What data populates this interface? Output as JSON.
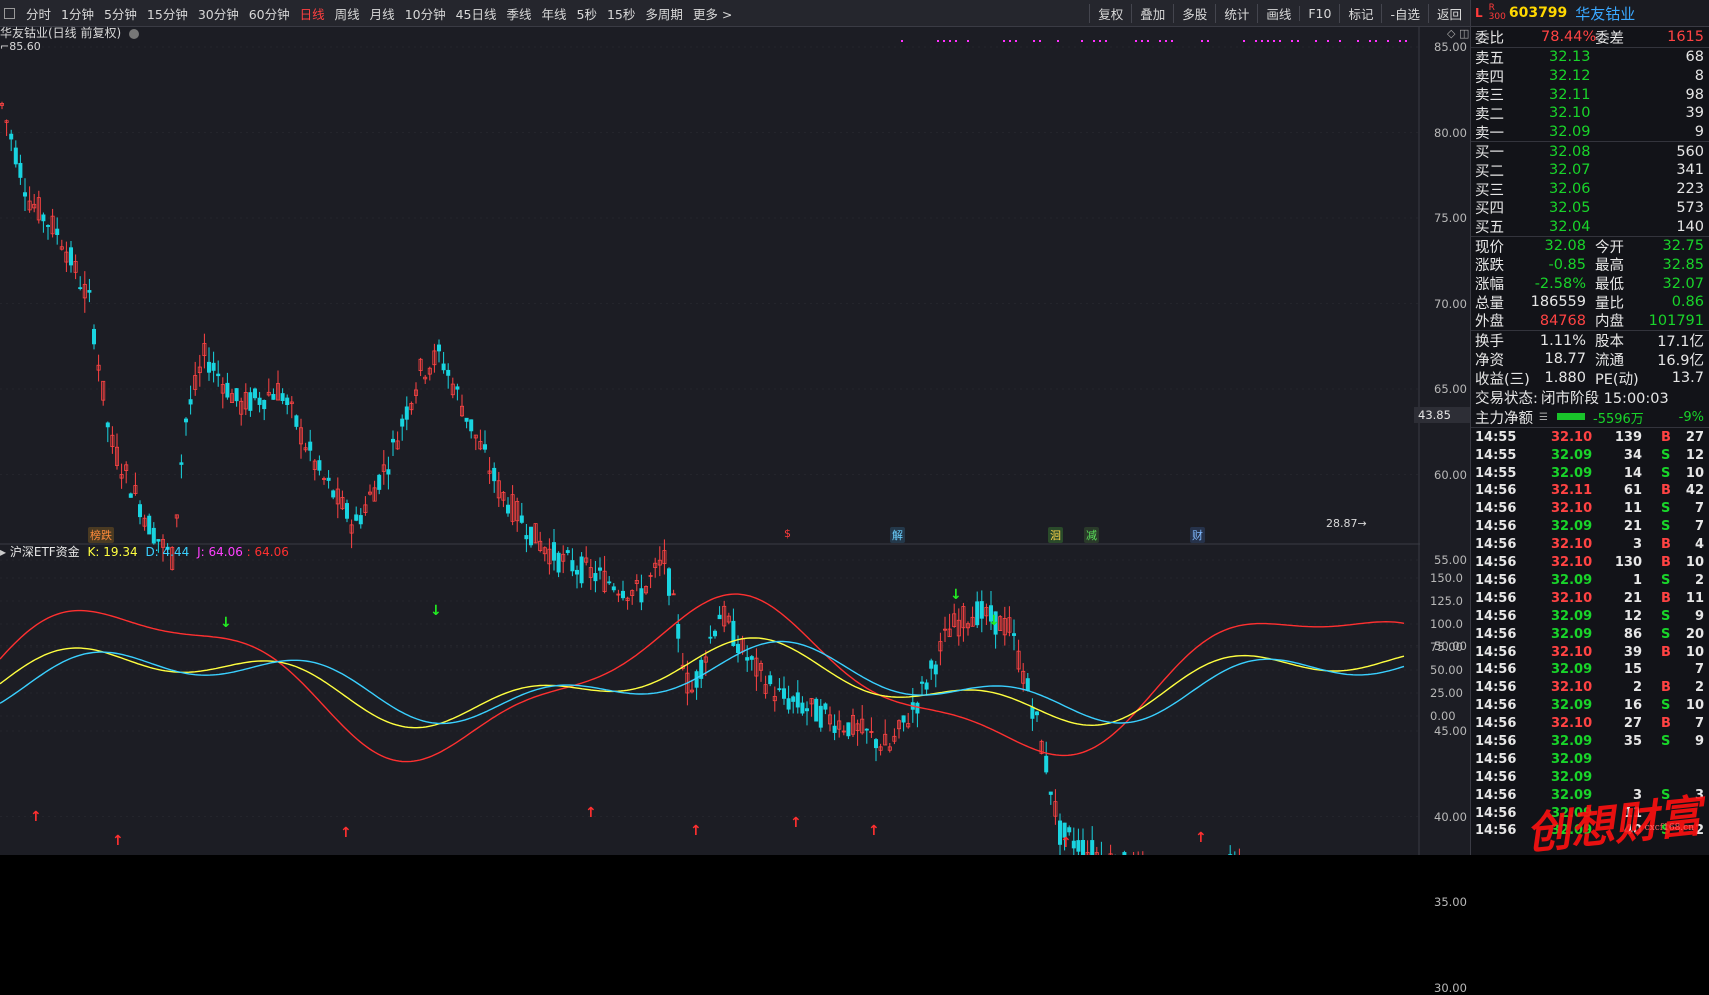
{
  "toolbar": {
    "periods": [
      "分时",
      "1分钟",
      "5分钟",
      "15分钟",
      "30分钟",
      "60分钟",
      "日线",
      "周线",
      "月线",
      "10分钟",
      "45日线",
      "季线",
      "年线",
      "5秒",
      "15秒",
      "多周期",
      "更多 >"
    ],
    "active_period": "日线",
    "right_tools": [
      "复权",
      "叠加",
      "多股",
      "统计",
      "画线",
      "F10",
      "标记",
      "-自选",
      "返回"
    ]
  },
  "main_chart": {
    "title": "华友钴业(日线 前复权)",
    "high_marker": "85.60",
    "low_marker": "28.87",
    "crosshair_price": "43.85",
    "y_ticks": [
      "85.00",
      "80.00",
      "75.00",
      "70.00",
      "65.00",
      "60.00",
      "55.00",
      "50.00",
      "45.00",
      "40.00",
      "35.00",
      "30.00"
    ],
    "events": [
      {
        "text": "榜跌",
        "color": "#ff8a3b",
        "bg": "#4a3a22"
      },
      {
        "text": "$",
        "color": "#ff3b3b",
        "bg": "transparent"
      },
      {
        "text": "解",
        "color": "#6ad0ff",
        "bg": "#24384a"
      },
      {
        "text": "洄",
        "color": "#ffd84a",
        "bg": "#2a4a2a"
      },
      {
        "text": "减",
        "color": "#5ae05a",
        "bg": "#2a3a2a"
      },
      {
        "text": "财",
        "color": "#7fb8ff",
        "bg": "#26324a"
      }
    ]
  },
  "indicator": {
    "name": "沪深ETF资金",
    "k_label": "K: 19.34",
    "d_label": "D: 4.44",
    "j_label": "J: 64.06",
    "extra_label": ": 64.06",
    "y_ticks": [
      "150.0",
      "125.0",
      "100.0",
      "75.00",
      "50.00",
      "25.00",
      "0.00"
    ]
  },
  "quote": {
    "flag_l": "L",
    "flag_r": "R",
    "flag_r_sub": "300",
    "code": "603799",
    "name": "华友钴业",
    "weibi_label": "委比",
    "weibi_value": "78.44%",
    "weicha_label": "委差",
    "weicha_value": "1615",
    "asks": [
      {
        "label": "卖五",
        "price": "32.13",
        "vol": "68"
      },
      {
        "label": "卖四",
        "price": "32.12",
        "vol": "8"
      },
      {
        "label": "卖三",
        "price": "32.11",
        "vol": "98"
      },
      {
        "label": "卖二",
        "price": "32.10",
        "vol": "39"
      },
      {
        "label": "卖一",
        "price": "32.09",
        "vol": "9"
      }
    ],
    "bids": [
      {
        "label": "买一",
        "price": "32.08",
        "vol": "560"
      },
      {
        "label": "买二",
        "price": "32.07",
        "vol": "341"
      },
      {
        "label": "买三",
        "price": "32.06",
        "vol": "223"
      },
      {
        "label": "买四",
        "price": "32.05",
        "vol": "573"
      },
      {
        "label": "买五",
        "price": "32.04",
        "vol": "140"
      }
    ],
    "stats": [
      {
        "l1": "现价",
        "v1": "32.08",
        "c1": "green",
        "l2": "今开",
        "v2": "32.75",
        "c2": "green"
      },
      {
        "l1": "涨跌",
        "v1": "-0.85",
        "c1": "green",
        "l2": "最高",
        "v2": "32.85",
        "c2": "green"
      },
      {
        "l1": "涨幅",
        "v1": "-2.58%",
        "c1": "green",
        "l2": "最低",
        "v2": "32.07",
        "c2": "green"
      },
      {
        "l1": "总量",
        "v1": "186559",
        "c1": "white",
        "l2": "量比",
        "v2": "0.86",
        "c2": "green"
      },
      {
        "l1": "外盘",
        "v1": "84768",
        "c1": "red",
        "l2": "内盘",
        "v2": "101791",
        "c2": "green"
      }
    ],
    "stats2": [
      {
        "l1": "换手",
        "v1": "1.11%",
        "l2": "股本",
        "v2": "17.1亿"
      },
      {
        "l1": "净资",
        "v1": "18.77",
        "l2": "流通",
        "v2": "16.9亿"
      },
      {
        "l1": "收益(三)",
        "v1": "1.880",
        "l2": "PE(动)",
        "v2": "13.7"
      }
    ],
    "trade_status_label": "交易状态:",
    "trade_status_value": "闭市阶段 15:00:03",
    "main_flow_label": "主力净额",
    "main_flow_value": "-5596万",
    "main_flow_pct": "-9%"
  },
  "ticks": [
    {
      "t": "14:55",
      "p": "32.10",
      "pc": "red",
      "v": "139",
      "s": "B",
      "n": "27"
    },
    {
      "t": "14:55",
      "p": "32.09",
      "pc": "green",
      "v": "34",
      "s": "S",
      "n": "12"
    },
    {
      "t": "14:55",
      "p": "32.09",
      "pc": "green",
      "v": "14",
      "s": "S",
      "n": "10"
    },
    {
      "t": "14:56",
      "p": "32.11",
      "pc": "red",
      "v": "61",
      "s": "B",
      "n": "42"
    },
    {
      "t": "14:56",
      "p": "32.10",
      "pc": "red",
      "v": "11",
      "s": "S",
      "n": "7"
    },
    {
      "t": "14:56",
      "p": "32.09",
      "pc": "green",
      "v": "21",
      "s": "S",
      "n": "7"
    },
    {
      "t": "14:56",
      "p": "32.10",
      "pc": "red",
      "v": "3",
      "s": "B",
      "n": "4"
    },
    {
      "t": "14:56",
      "p": "32.10",
      "pc": "red",
      "v": "130",
      "s": "B",
      "n": "10"
    },
    {
      "t": "14:56",
      "p": "32.09",
      "pc": "green",
      "v": "1",
      "s": "S",
      "n": "2"
    },
    {
      "t": "14:56",
      "p": "32.10",
      "pc": "red",
      "v": "21",
      "s": "B",
      "n": "11"
    },
    {
      "t": "14:56",
      "p": "32.09",
      "pc": "green",
      "v": "12",
      "s": "S",
      "n": "9"
    },
    {
      "t": "14:56",
      "p": "32.09",
      "pc": "green",
      "v": "86",
      "s": "S",
      "n": "20"
    },
    {
      "t": "14:56",
      "p": "32.10",
      "pc": "red",
      "v": "39",
      "s": "B",
      "n": "10"
    },
    {
      "t": "14:56",
      "p": "32.09",
      "pc": "green",
      "v": "15",
      "s": "",
      "n": "7"
    },
    {
      "t": "14:56",
      "p": "32.10",
      "pc": "red",
      "v": "2",
      "s": "B",
      "n": "2"
    },
    {
      "t": "14:56",
      "p": "32.09",
      "pc": "green",
      "v": "16",
      "s": "S",
      "n": "10"
    },
    {
      "t": "14:56",
      "p": "32.10",
      "pc": "red",
      "v": "27",
      "s": "B",
      "n": "7"
    },
    {
      "t": "14:56",
      "p": "32.09",
      "pc": "green",
      "v": "35",
      "s": "S",
      "n": "9"
    },
    {
      "t": "14:56",
      "p": "32.09",
      "pc": "green",
      "v": "",
      "s": "",
      "n": ""
    },
    {
      "t": "14:56",
      "p": "32.09",
      "pc": "green",
      "v": "",
      "s": "",
      "n": ""
    },
    {
      "t": "14:56",
      "p": "32.09",
      "pc": "green",
      "v": "3",
      "s": "S",
      "n": "3"
    },
    {
      "t": "14:56",
      "p": "32.09",
      "pc": "green",
      "v": "11",
      "s": "",
      "n": ""
    },
    {
      "t": "14:56",
      "p": "32.09",
      "pc": "green",
      "v": "40",
      "s": "S",
      "n": "2"
    }
  ],
  "watermark": {
    "text": "创想财富",
    "sub": "cxcf168.cn"
  },
  "colors": {
    "up": "#ff4343",
    "down": "#19d4e0",
    "k": "#ffff40",
    "d": "#3ad0ff",
    "j": "#ff3030",
    "j_down": "#22cc22",
    "bg": "#1c1d24"
  }
}
